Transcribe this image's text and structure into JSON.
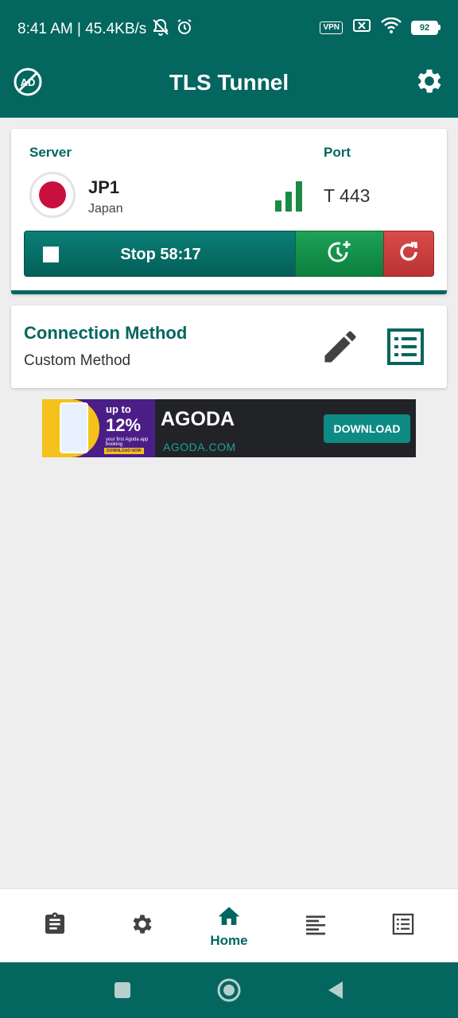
{
  "status_bar": {
    "time_and_speed": "8:41 AM | 45.4KB/s",
    "vpn_label": "VPN",
    "battery_level": "92",
    "icons": [
      "mute-bell-icon",
      "alarm-icon",
      "vpn-icon",
      "no-sim-icon",
      "wifi-icon",
      "battery-icon"
    ]
  },
  "app_bar": {
    "title": "TLS Tunnel",
    "left_icon": "no-ads-icon",
    "right_icon": "gear-icon"
  },
  "server_card": {
    "server_label": "Server",
    "port_label": "Port",
    "server_name": "JP1",
    "server_country": "Japan",
    "port_value": "T 443",
    "signal_icon": "signal-bars-icon",
    "stop_button_label": "Stop 58:17",
    "colors": {
      "accent": "#03665f",
      "timer_green": "#1a9a52",
      "refresh_red": "#cc3e3e",
      "flag_red": "#c8103e"
    }
  },
  "method_card": {
    "title": "Connection Method",
    "value": "Custom Method"
  },
  "ad": {
    "promo_line1": "up to",
    "promo_line2": "12%",
    "promo_line3": "your first Agoda app booking",
    "promo_line4": "DOWNLOAD NOW",
    "title": "AGODA",
    "domain": "AGODA.COM",
    "cta": "DOWNLOAD"
  },
  "bottom_nav": {
    "items": [
      {
        "icon": "clipboard-icon",
        "label": ""
      },
      {
        "icon": "gear-icon",
        "label": ""
      },
      {
        "icon": "home-icon",
        "label": "Home"
      },
      {
        "icon": "text-lines-icon",
        "label": ""
      },
      {
        "icon": "list-icon",
        "label": ""
      }
    ]
  },
  "system_nav": {
    "icons": [
      "recents-square-icon",
      "home-circle-icon",
      "back-triangle-icon"
    ]
  }
}
